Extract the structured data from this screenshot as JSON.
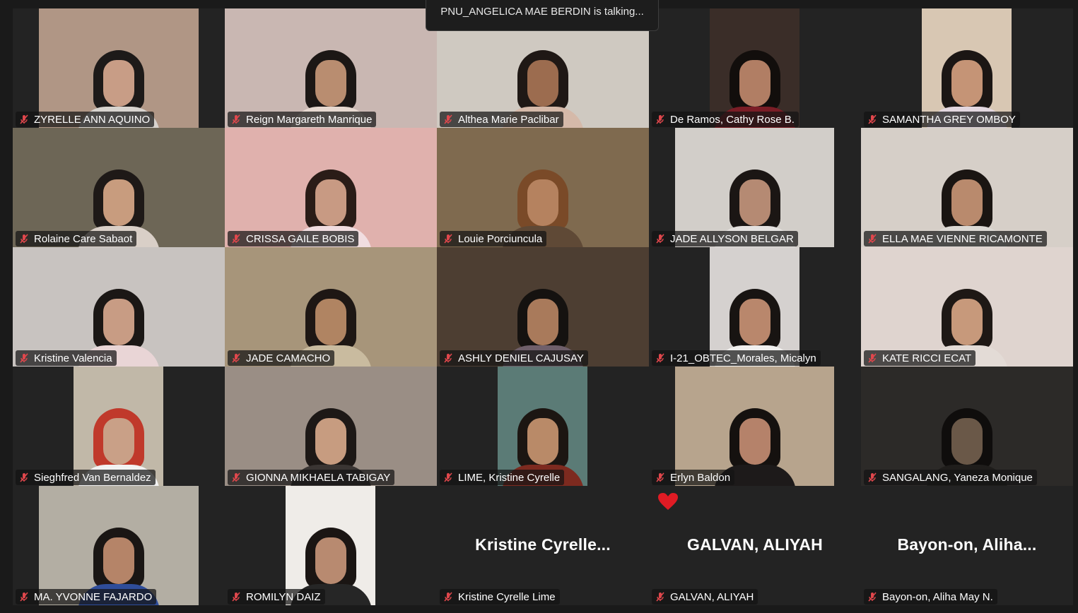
{
  "banner": {
    "talking_text": "PNU_ANGELICA MAE BERDIN is talking..."
  },
  "colors": {
    "background": "#1a1a1a",
    "tile": "#232323",
    "mic_muted": "#e0474c",
    "heart": "#e01b24"
  },
  "participants": [
    {
      "name": "ZYRELLE ANN AQUINO",
      "video": true,
      "bg": "#b09685",
      "hair": "#1d1a19",
      "skin": "#c89d86",
      "shirt": "#d8d4cf"
    },
    {
      "name": "Reign Margareth Manrique",
      "video": true,
      "bg": "#c9b7b2",
      "hair": "#1c1715",
      "skin": "#b98d70",
      "shirt": "#e7d9d0"
    },
    {
      "name": "Althea Marie Paclibar",
      "video": true,
      "bg": "#cfc9c1",
      "hair": "#1f1815",
      "skin": "#9c6c4f",
      "shirt": "#d5b9a9"
    },
    {
      "name": "De Ramos, Cathy Rose B.",
      "video": true,
      "bg": "#3a2d28",
      "hair": "#120e0c",
      "skin": "#b17e64",
      "shirt": "#7a1d26"
    },
    {
      "name": "SAMANTHA GREY OMBOY",
      "video": true,
      "bg": "#d8c7b3",
      "hair": "#1b1614",
      "skin": "#c59476",
      "shirt": "#e3d7e0"
    },
    {
      "name": "Rolaine Care Sabaot",
      "video": true,
      "bg": "#6d6656",
      "hair": "#1e1917",
      "skin": "#c89c7e",
      "shirt": "#d9cfc7"
    },
    {
      "name": "CRISSA GAILE BOBIS",
      "video": true,
      "bg": "#e0b1ad",
      "hair": "#2a1c17",
      "skin": "#c89a83",
      "shirt": "#f1dde0"
    },
    {
      "name": "Louie Porciuncula",
      "video": true,
      "bg": "#7f6a4f",
      "hair": "#7a4a28",
      "skin": "#b5825f",
      "shirt": "#5f4936"
    },
    {
      "name": "JADE ALLYSON BELGAR",
      "video": true,
      "bg": "#d2cec9",
      "hair": "#1b1614",
      "skin": "#b58a73",
      "shirt": "#e4e1df"
    },
    {
      "name": "ELLA MAE VIENNE RICAMONTE",
      "video": true,
      "bg": "#d6cfc8",
      "hair": "#1a1512",
      "skin": "#b98a6d",
      "shirt": "#dcd9d4"
    },
    {
      "name": "Kristine Valencia",
      "video": true,
      "bg": "#c8c3c0",
      "hair": "#1b1715",
      "skin": "#c89c84",
      "shirt": "#e9d5d6"
    },
    {
      "name": "JADE CAMACHO",
      "video": true,
      "bg": "#a7957a",
      "hair": "#1e1714",
      "skin": "#b08462",
      "shirt": "#c9bb9f"
    },
    {
      "name": "ASHLY DENIEL CAJUSAY",
      "video": true,
      "bg": "#4d3e32",
      "hair": "#151210",
      "skin": "#a97a5b",
      "shirt": "#6f5f6a"
    },
    {
      "name": "I-21_OBTEC_Morales, Micalyn",
      "video": true,
      "bg": "#d5d1cf",
      "hair": "#181412",
      "skin": "#b9876c",
      "shirt": "#f1f0ef"
    },
    {
      "name": "KATE RICCI ECAT",
      "video": true,
      "bg": "#dfd4cf",
      "hair": "#1e1815",
      "skin": "#c7997b",
      "shirt": "#e3dbd6"
    },
    {
      "name": "Sieghfred Van Bernaldez",
      "video": true,
      "bg": "#c1b8a8",
      "hair": "#c0392b",
      "skin": "#c9a087",
      "shirt": "#f2f2f2"
    },
    {
      "name": "GIONNA MIKHAELA TABIGAY",
      "video": true,
      "bg": "#9a8e85",
      "hair": "#1d1816",
      "skin": "#c79c80",
      "shirt": "#3a3533"
    },
    {
      "name": "LIME, Kristine Cyrelle",
      "video": true,
      "bg": "#5b7b76",
      "hair": "#1c1612",
      "skin": "#b98a68",
      "shirt": "#7d2a1f"
    },
    {
      "name": "Erlyn Baldon",
      "video": true,
      "bg": "#b7a48d",
      "hair": "#15110f",
      "skin": "#b5826a",
      "shirt": "#1d1a1a"
    },
    {
      "name": "SANGALANG, Yaneza Monique",
      "video": true,
      "bg": "#2c2a28",
      "hair": "#0f0d0c",
      "skin": "#6a5848",
      "shirt": "#1f1d1b"
    },
    {
      "name": "MA. YVONNE FAJARDO",
      "video": true,
      "bg": "#b3aea3",
      "hair": "#1a1614",
      "skin": "#b58468",
      "shirt": "#2f4d9a"
    },
    {
      "name": "ROMILYN DAIZ",
      "video": true,
      "bg": "#efece8",
      "hair": "#1a1513",
      "skin": "#b88a70",
      "shirt": "#262626"
    },
    {
      "name": "Kristine Cyrelle Lime",
      "video": false,
      "display_name": "Kristine  Cyrelle..."
    },
    {
      "name": "GALVAN, ALIYAH",
      "video": false,
      "display_name": "GALVAN, ALIYAH",
      "reaction": "heart-icon"
    },
    {
      "name": "Bayon-on, Aliha May N.",
      "video": false,
      "display_name": "Bayon-on,  Aliha..."
    }
  ]
}
